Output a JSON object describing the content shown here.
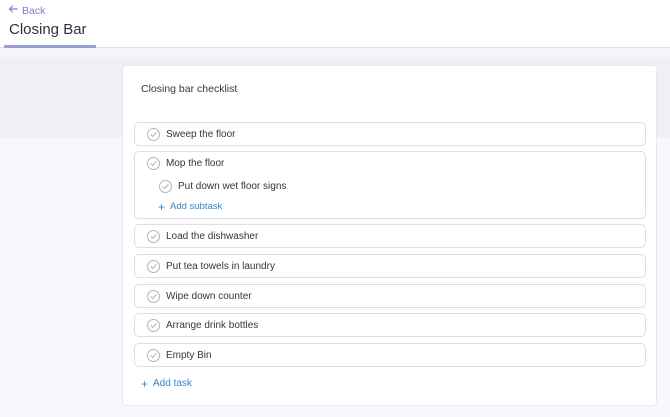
{
  "header": {
    "back_label": "Back",
    "title": "Closing Bar"
  },
  "checklist": {
    "title": "Closing bar checklist",
    "tasks": [
      {
        "label": "Sweep the floor"
      },
      {
        "label": "Mop the floor",
        "subtasks": [
          {
            "label": "Put down wet floor signs"
          }
        ],
        "add_subtask_label": "Add subtask"
      },
      {
        "label": "Load the dishwasher"
      },
      {
        "label": "Put tea towels in laundry"
      },
      {
        "label": "Wipe down counter"
      },
      {
        "label": "Arrange drink bottles"
      },
      {
        "label": "Empty Bin"
      }
    ],
    "add_task_label": "Add task"
  },
  "colors": {
    "accent_link": "#3b86c4",
    "back_link": "#7b80c9",
    "tab_underline": "#9a9ed6"
  }
}
